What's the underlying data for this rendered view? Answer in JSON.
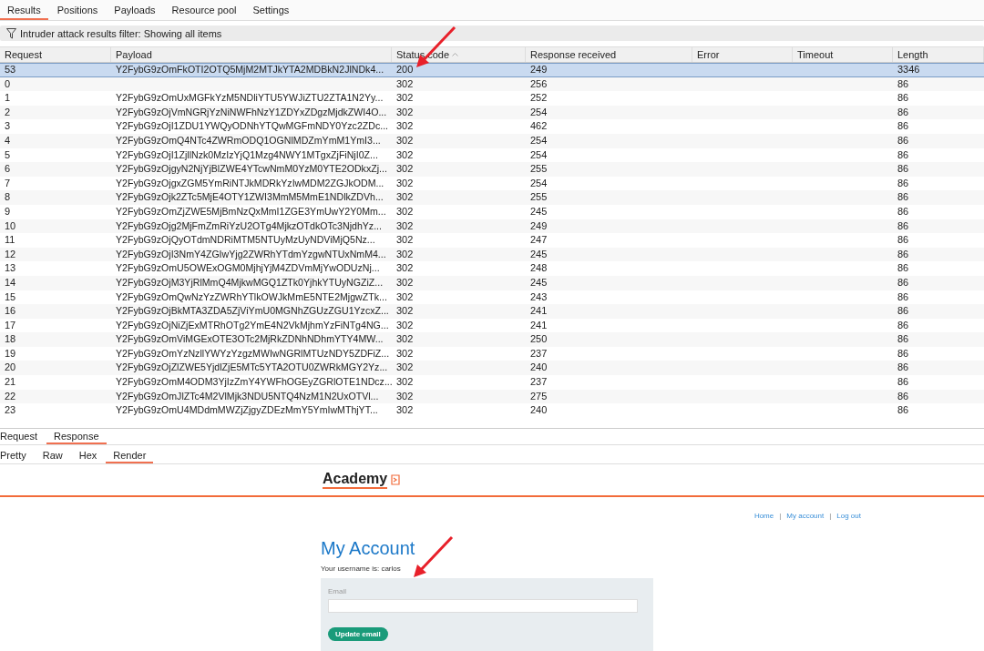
{
  "tabs": [
    {
      "label": "Results",
      "selected": true
    },
    {
      "label": "Positions",
      "selected": false
    },
    {
      "label": "Payloads",
      "selected": false
    },
    {
      "label": "Resource pool",
      "selected": false
    },
    {
      "label": "Settings",
      "selected": false
    }
  ],
  "filter": {
    "text": "Intruder attack results filter: Showing all items"
  },
  "table": {
    "columns": [
      {
        "label": "Request",
        "sorted": false
      },
      {
        "label": "Payload",
        "sorted": false
      },
      {
        "label": "Status code",
        "sorted": true
      },
      {
        "label": "Response received",
        "sorted": false
      },
      {
        "label": "Error",
        "sorted": false
      },
      {
        "label": "Timeout",
        "sorted": false
      },
      {
        "label": "Length",
        "sorted": false
      }
    ],
    "rows": [
      {
        "request": "53",
        "payload": "Y2FybG9zOmFkOTI2OTQ5MjM2MTJkYTA2MDBkN2JlNDk4...",
        "status": "200",
        "received": "249",
        "length": "3346",
        "selected": true
      },
      {
        "request": "0",
        "payload": "",
        "status": "302",
        "received": "256",
        "length": "86",
        "selected": false
      },
      {
        "request": "1",
        "payload": "Y2FybG9zOmUxMGFkYzM5NDliYTU5YWJiZTU2ZTA1N2Yy...",
        "status": "302",
        "received": "252",
        "length": "86",
        "selected": false
      },
      {
        "request": "2",
        "payload": "Y2FybG9zOjVmNGRjYzNiNWFhNzY1ZDYxZDgzMjdkZWI4O...",
        "status": "302",
        "received": "254",
        "length": "86",
        "selected": false
      },
      {
        "request": "3",
        "payload": "Y2FybG9zOjI1ZDU1YWQyODNhYTQwMGFmNDY0Yzc2ZDc...",
        "status": "302",
        "received": "462",
        "length": "86",
        "selected": false
      },
      {
        "request": "4",
        "payload": "Y2FybG9zOmQ4NTc4ZWRmODQ1OGNlMDZmYmM1YmI3...",
        "status": "302",
        "received": "254",
        "length": "86",
        "selected": false
      },
      {
        "request": "5",
        "payload": "Y2FybG9zOjI1ZjllNzk0MzIzYjQ1Mzg4NWY1MTgxZjFiNjI0Z...",
        "status": "302",
        "received": "254",
        "length": "86",
        "selected": false
      },
      {
        "request": "6",
        "payload": "Y2FybG9zOjgyN2NjYjBlZWE4YTcwNmM0YzM0YTE2ODkxZj...",
        "status": "302",
        "received": "255",
        "length": "86",
        "selected": false
      },
      {
        "request": "7",
        "payload": "Y2FybG9zOjgxZGM5YmRiNTJkMDRkYzIwMDM2ZGJkODM...",
        "status": "302",
        "received": "254",
        "length": "86",
        "selected": false
      },
      {
        "request": "8",
        "payload": "Y2FybG9zOjk2ZTc5MjE4OTY1ZWI3MmM5MmE1NDlkZDVh...",
        "status": "302",
        "received": "255",
        "length": "86",
        "selected": false
      },
      {
        "request": "9",
        "payload": "Y2FybG9zOmZjZWE5MjBmNzQxMmI1ZGE3YmUwY2Y0Mm...",
        "status": "302",
        "received": "245",
        "length": "86",
        "selected": false
      },
      {
        "request": "10",
        "payload": "Y2FybG9zOjg2MjFmZmRiYzU2OTg4MjkzOTdkOTc3NjdhYz...",
        "status": "302",
        "received": "249",
        "length": "86",
        "selected": false
      },
      {
        "request": "11",
        "payload": "Y2FybG9zOjQyOTdmNDRiMTM5NTUyMzUyNDViMjQ5Nz...",
        "status": "302",
        "received": "247",
        "length": "86",
        "selected": false
      },
      {
        "request": "12",
        "payload": "Y2FybG9zOjI3NmY4ZGIwYjg2ZWRhYTdmYzgwNTUxNmM4...",
        "status": "302",
        "received": "245",
        "length": "86",
        "selected": false
      },
      {
        "request": "13",
        "payload": "Y2FybG9zOmU5OWExOGM0MjhjYjM4ZDVmMjYwODUzNj...",
        "status": "302",
        "received": "248",
        "length": "86",
        "selected": false
      },
      {
        "request": "14",
        "payload": "Y2FybG9zOjM3YjRlMmQ4MjkwMGQ1ZTk0YjhkYTUyNGZiZ...",
        "status": "302",
        "received": "245",
        "length": "86",
        "selected": false
      },
      {
        "request": "15",
        "payload": "Y2FybG9zOmQwNzYzZWRhYTlkOWJkMmE5NTE2MjgwZTk...",
        "status": "302",
        "received": "243",
        "length": "86",
        "selected": false
      },
      {
        "request": "16",
        "payload": "Y2FybG9zOjBkMTA3ZDA5ZjViYmU0MGNhZGUzZGU1YzcxZ...",
        "status": "302",
        "received": "241",
        "length": "86",
        "selected": false
      },
      {
        "request": "17",
        "payload": "Y2FybG9zOjNiZjExMTRhOTg2YmE4N2VkMjhmYzFiNTg4NG...",
        "status": "302",
        "received": "241",
        "length": "86",
        "selected": false
      },
      {
        "request": "18",
        "payload": "Y2FybG9zOmViMGExOTE3OTc2MjRkZDNhNDhmYTY4MW...",
        "status": "302",
        "received": "250",
        "length": "86",
        "selected": false
      },
      {
        "request": "19",
        "payload": "Y2FybG9zOmYzNzllYWYzYzgzMWIwNGRlMTUzNDY5ZDFiZ...",
        "status": "302",
        "received": "237",
        "length": "86",
        "selected": false
      },
      {
        "request": "20",
        "payload": "Y2FybG9zOjZlZWE5YjdlZjE5MTc5YTA2OTU0ZWRkMGY2Yz...",
        "status": "302",
        "received": "240",
        "length": "86",
        "selected": false
      },
      {
        "request": "21",
        "payload": "Y2FybG9zOmM4ODM3YjIzZmY4YWFhOGEyZGRlOTE1NDcz...",
        "status": "302",
        "received": "237",
        "length": "86",
        "selected": false
      },
      {
        "request": "22",
        "payload": "Y2FybG9zOmJlZTc4M2VlMjk3NDU5NTQ4NzM1N2UxOTVl...",
        "status": "302",
        "received": "275",
        "length": "86",
        "selected": false
      },
      {
        "request": "23",
        "payload": "Y2FybG9zOmU4MDdmMWZjZjgyZDEzMmY5YmIwMThjYT...",
        "status": "302",
        "received": "240",
        "length": "86",
        "selected": false
      }
    ]
  },
  "message_tabs": [
    {
      "label": "Request",
      "selected": false
    },
    {
      "label": "Response",
      "selected": true
    }
  ],
  "view_tabs": [
    {
      "label": "Pretty",
      "selected": false
    },
    {
      "label": "Raw",
      "selected": false
    },
    {
      "label": "Hex",
      "selected": false
    },
    {
      "label": "Render",
      "selected": true
    }
  ],
  "render": {
    "logo": "Academy",
    "nav": [
      "Home",
      "My account",
      "Log out"
    ],
    "nav_separator": "|",
    "heading": "My Account",
    "username_line": "Your username is: carlos",
    "email": {
      "label": "Email"
    },
    "button": "Update email"
  }
}
